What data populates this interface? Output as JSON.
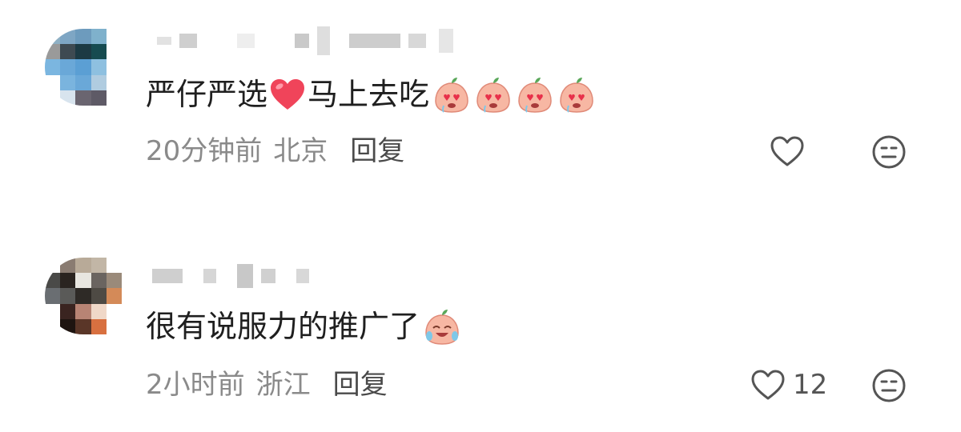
{
  "comments": [
    {
      "username": "",
      "text_before": "严仔严选",
      "text_after": "马上去吃",
      "emoji_names": [
        "heart-eyes-peach-emoji",
        "heart-eyes-peach-emoji",
        "heart-eyes-peach-emoji",
        "heart-eyes-peach-emoji"
      ],
      "time": "20分钟前",
      "location": "北京",
      "reply_label": "回复",
      "like_count": "",
      "icons": {
        "like": "heart-outline-icon",
        "dislike": "neutral-face-icon"
      }
    },
    {
      "username": "",
      "text_before": "很有说服力的推广了",
      "text_after": "",
      "emoji_names": [
        "crying-laughing-peach-emoji"
      ],
      "time": "2小时前",
      "location": "浙江",
      "reply_label": "回复",
      "like_count": "12",
      "icons": {
        "like": "heart-outline-icon",
        "dislike": "neutral-face-icon"
      }
    }
  ],
  "colors": {
    "text": "#1f1f1f",
    "meta": "#8a8a8a",
    "reply": "#4a4a4a",
    "heart_red": "#f0445a",
    "peach": "#f7b7a3"
  }
}
